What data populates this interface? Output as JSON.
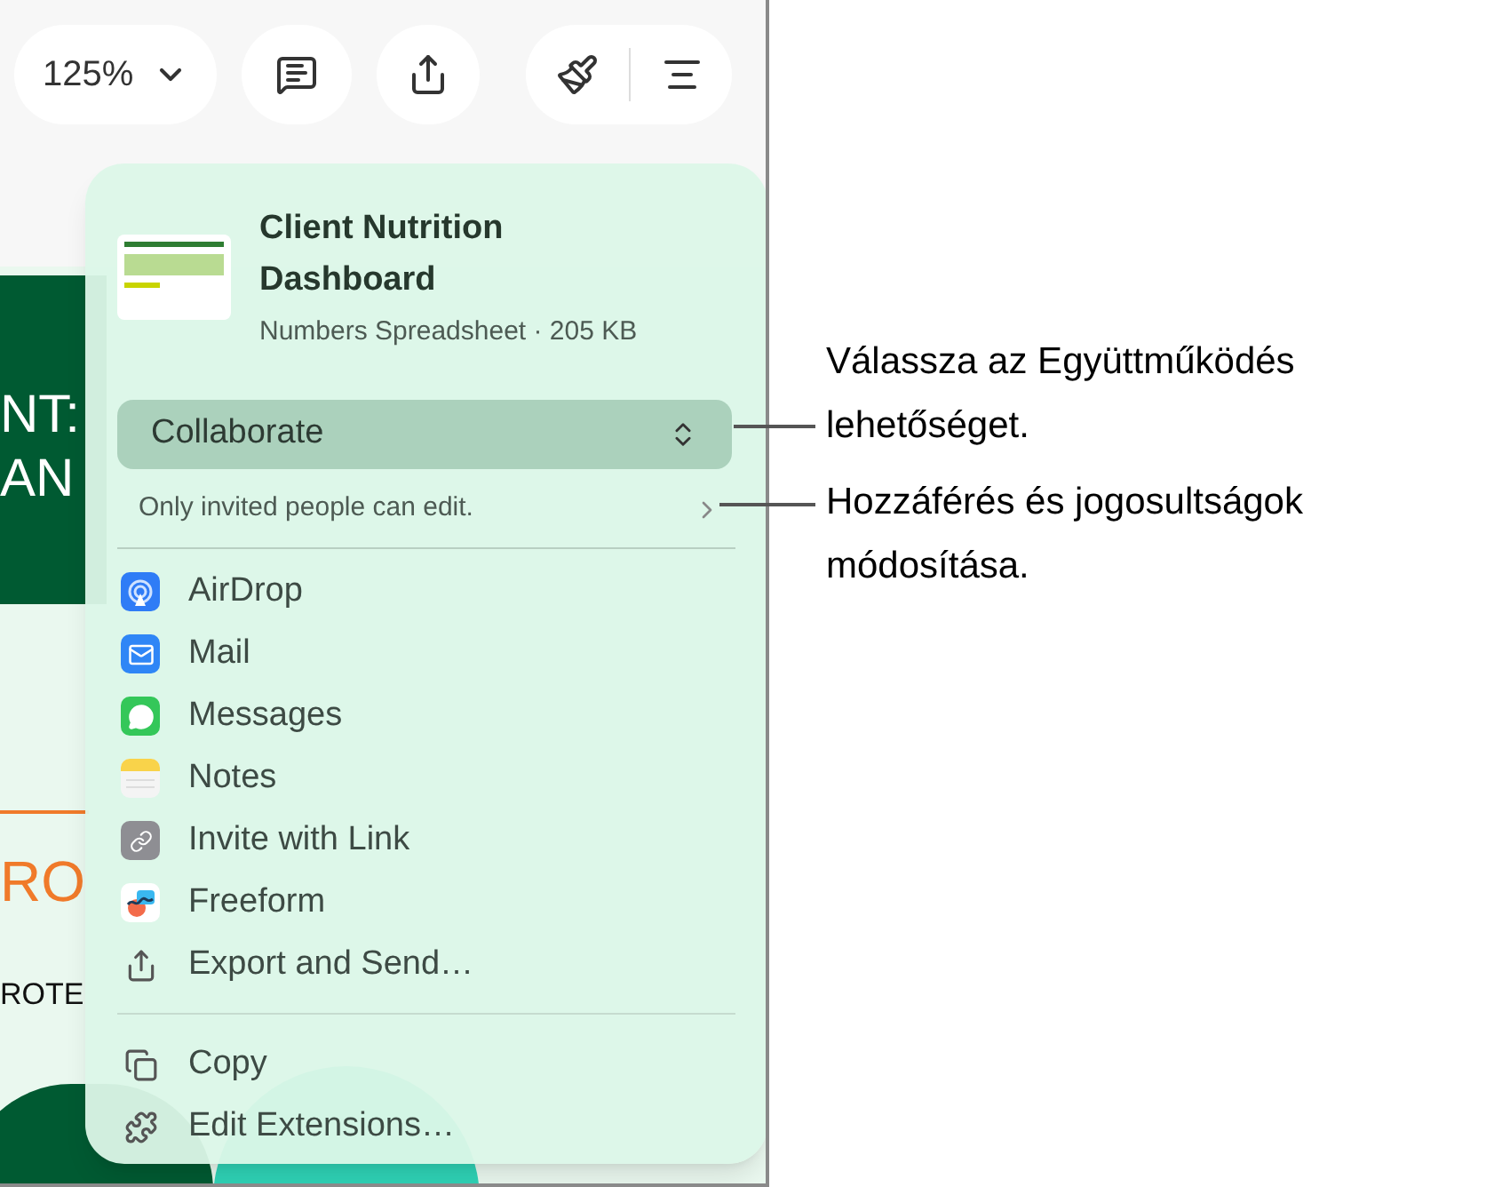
{
  "toolbar": {
    "zoom": "125%"
  },
  "document": {
    "heading_lines": [
      "NT:",
      "AN"
    ],
    "orange_text": "RO",
    "small_text": "ROTE"
  },
  "share_popover": {
    "file": {
      "title": "Client Nutrition Dashboard",
      "subtitle": "Numbers Spreadsheet · 205 KB"
    },
    "access_menu": {
      "label": "Collaborate"
    },
    "permissions": "Only invited people can edit.",
    "targets": [
      {
        "label": "AirDrop",
        "kind": "airdrop"
      },
      {
        "label": "Mail",
        "kind": "mail"
      },
      {
        "label": "Messages",
        "kind": "messages"
      },
      {
        "label": "Notes",
        "kind": "notes"
      },
      {
        "label": "Invite with Link",
        "kind": "link"
      },
      {
        "label": "Freeform",
        "kind": "freeform"
      },
      {
        "label": "Export and Send…",
        "kind": "export"
      }
    ],
    "actions": [
      {
        "label": "Copy",
        "kind": "copy"
      },
      {
        "label": "Edit Extensions…",
        "kind": "extensions"
      }
    ]
  },
  "callouts": [
    {
      "text": "Válassza az Együttműködés lehetőséget."
    },
    {
      "text": "Hozzáférés és jogosultságok módosítása."
    }
  ]
}
